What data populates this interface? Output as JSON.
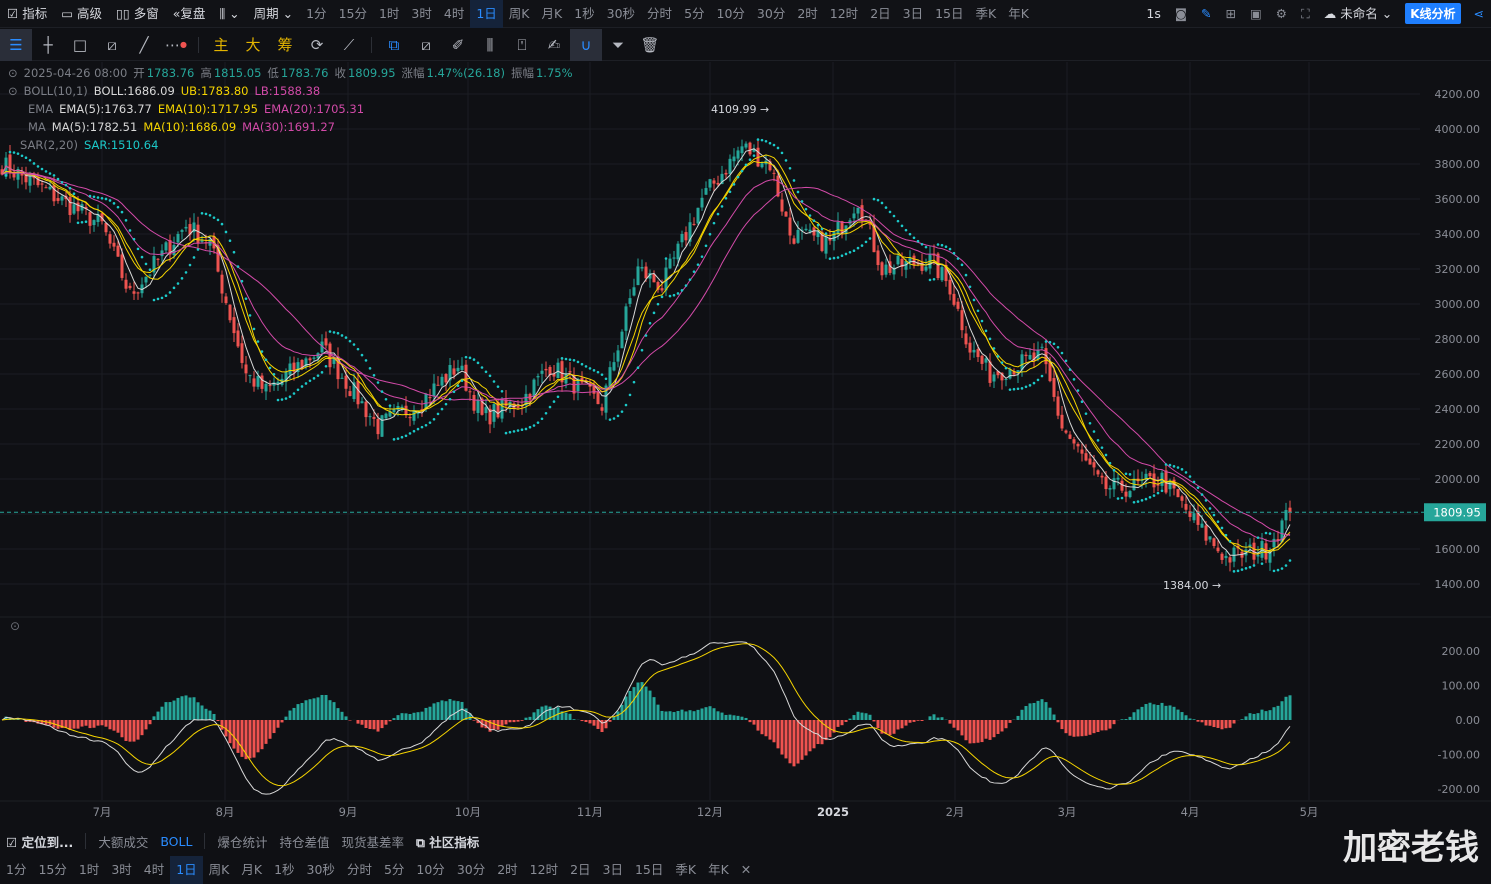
{
  "top": {
    "items": [
      "指标",
      "高级",
      "多窗",
      "复盘"
    ],
    "chart_type_icon": "candlestick-icon",
    "period_label": "周期",
    "intervals": [
      "1分",
      "15分",
      "1时",
      "3时",
      "4时",
      "1日",
      "周K",
      "月K",
      "1秒",
      "30秒",
      "分时",
      "5分",
      "10分",
      "30分",
      "2时",
      "12时",
      "2日",
      "3日",
      "15日",
      "季K",
      "年K"
    ],
    "active_interval": "1日",
    "refresh": "1s",
    "layout_name": "未命名",
    "analysis_button": "K线分析"
  },
  "tools": {
    "main": "主",
    "big": "大",
    "chips": "筹"
  },
  "legend": {
    "date": "2025-04-26 08:00",
    "open_l": "开",
    "open": "1783.76",
    "high_l": "高",
    "high": "1815.05",
    "low_l": "低",
    "low": "1783.76",
    "close_l": "收",
    "close": "1809.95",
    "chg_l": "涨幅",
    "chg": "1.47%(26.18)",
    "amp_l": "振幅",
    "amp": "1.75%",
    "boll_name": "BOLL(10,1)",
    "boll": "BOLL:1686.09",
    "ub": "UB:1783.80",
    "lb": "LB:1588.38",
    "ema_name": "EMA",
    "ema5": "EMA(5):1763.77",
    "ema10": "EMA(10):1717.95",
    "ema20": "EMA(20):1705.31",
    "ma_name": "MA",
    "ma5": "MA(5):1782.51",
    "ma10": "MA(10):1686.09",
    "ma30": "MA(30):1691.27",
    "sar_name": "SAR(2,20)",
    "sar": "SAR:1510.64"
  },
  "chart_data": {
    "type": "candlestick",
    "price_ticks": [
      4200,
      4000,
      3800,
      3600,
      3400,
      3200,
      3000,
      2800,
      2600,
      2400,
      2200,
      2000,
      1800,
      1600,
      1400
    ],
    "ylim": [
      1400,
      4200
    ],
    "macd_ticks": [
      "200.00",
      "100.00",
      "0.00",
      "-100.00",
      "-200.00"
    ],
    "x_labels": [
      "7月",
      "8月",
      "9月",
      "10月",
      "11月",
      "12月",
      "2025",
      "2月",
      "3月",
      "4月",
      "5月"
    ],
    "last_price": "1809.95",
    "high_marker": "4109.99 →",
    "low_marker": "1384.00 →",
    "close_keypoints": [
      [
        0,
        3800
      ],
      [
        25,
        3450
      ],
      [
        32,
        3050
      ],
      [
        46,
        3450
      ],
      [
        52,
        3350
      ],
      [
        61,
        2600
      ],
      [
        66,
        2500
      ],
      [
        80,
        2750
      ],
      [
        94,
        2300
      ],
      [
        105,
        2450
      ],
      [
        114,
        2650
      ],
      [
        120,
        2350
      ],
      [
        130,
        2450
      ],
      [
        137,
        2650
      ],
      [
        150,
        2420
      ],
      [
        159,
        3200
      ],
      [
        165,
        3100
      ],
      [
        175,
        3600
      ],
      [
        185,
        3900
      ],
      [
        192,
        3800
      ],
      [
        197,
        3400
      ],
      [
        207,
        3350
      ],
      [
        214,
        3600
      ],
      [
        220,
        3200
      ],
      [
        232,
        3250
      ],
      [
        237,
        3100
      ],
      [
        242,
        2750
      ],
      [
        247,
        2600
      ],
      [
        260,
        2700
      ],
      [
        265,
        2300
      ],
      [
        275,
        1950
      ],
      [
        282,
        1950
      ],
      [
        290,
        2000
      ],
      [
        300,
        1700
      ],
      [
        306,
        1550
      ],
      [
        316,
        1600
      ],
      [
        322,
        1810
      ]
    ],
    "colors": {
      "up": "#26a69a",
      "down": "#ef5350",
      "ma5": "#d8d8d8",
      "ma10": "#f5d400",
      "ma30": "#d24aa8",
      "sar": "#1cc9c9"
    }
  },
  "bottom": {
    "locate": "定位到...",
    "items": [
      "大额成交",
      "BOLL",
      "爆仓统计",
      "持仓差值",
      "现货基差率"
    ],
    "community": "社区指标",
    "intervals": [
      "1分",
      "15分",
      "1时",
      "3时",
      "4时",
      "1日",
      "周K",
      "月K",
      "1秒",
      "30秒",
      "分时",
      "5分",
      "10分",
      "30分",
      "2时",
      "12时",
      "2日",
      "3日",
      "15日",
      "季K",
      "年K"
    ],
    "close": "✕"
  },
  "watermark": "加密老钱"
}
